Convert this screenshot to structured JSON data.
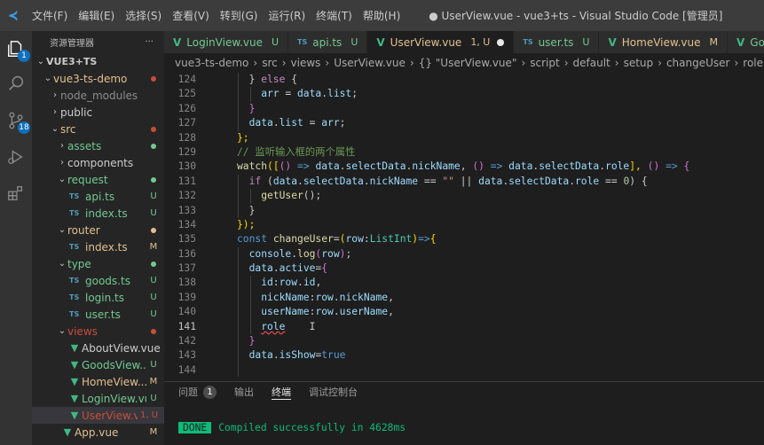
{
  "titlebar": {
    "menus": [
      "文件(F)",
      "编辑(E)",
      "选择(S)",
      "查看(V)",
      "转到(G)",
      "运行(R)",
      "终端(T)",
      "帮助(H)"
    ],
    "window_title": "● UserView.vue - vue3+ts - Visual Studio Code [管理员]"
  },
  "activity": {
    "scm_badge": "18",
    "explorer_badge": "1"
  },
  "sidebar": {
    "header": "资源管理器",
    "more": "···",
    "tree": [
      {
        "chev": "⌄",
        "label": "VUE3+TS",
        "depth": 0,
        "kind": "root"
      },
      {
        "chev": "⌄",
        "label": "vue3-ts-demo",
        "depth": 1,
        "kind": "folder",
        "color": "#e2c08d",
        "dot": "#c74e39"
      },
      {
        "chev": "›",
        "label": "node_modules",
        "depth": 2,
        "kind": "folder",
        "color": "#8c8c8c"
      },
      {
        "chev": "›",
        "label": "public",
        "depth": 2,
        "kind": "folder"
      },
      {
        "chev": "⌄",
        "label": "src",
        "depth": 2,
        "kind": "folder",
        "color": "#e2c08d",
        "dot": "#c74e39"
      },
      {
        "chev": "›",
        "label": "assets",
        "depth": 3,
        "kind": "folder",
        "color": "#73c991",
        "dot": "#73c991"
      },
      {
        "chev": "›",
        "label": "components",
        "depth": 3,
        "kind": "folder"
      },
      {
        "chev": "⌄",
        "label": "request",
        "depth": 3,
        "kind": "folder",
        "color": "#73c991",
        "dot": "#73c991"
      },
      {
        "label": "api.ts",
        "depth": 4,
        "kind": "ts",
        "color": "#73c991",
        "status": "U"
      },
      {
        "label": "index.ts",
        "depth": 4,
        "kind": "ts",
        "color": "#73c991",
        "status": "U"
      },
      {
        "chev": "⌄",
        "label": "router",
        "depth": 3,
        "kind": "folder",
        "color": "#e2c08d",
        "dot": "#e2c08d"
      },
      {
        "label": "index.ts",
        "depth": 4,
        "kind": "ts",
        "color": "#e2c08d",
        "status": "M"
      },
      {
        "chev": "⌄",
        "label": "type",
        "depth": 3,
        "kind": "folder",
        "color": "#73c991",
        "dot": "#73c991"
      },
      {
        "label": "goods.ts",
        "depth": 4,
        "kind": "ts",
        "color": "#73c991",
        "status": "U"
      },
      {
        "label": "login.ts",
        "depth": 4,
        "kind": "ts",
        "color": "#73c991",
        "status": "U"
      },
      {
        "label": "user.ts",
        "depth": 4,
        "kind": "ts",
        "color": "#73c991",
        "status": "U"
      },
      {
        "chev": "⌄",
        "label": "views",
        "depth": 3,
        "kind": "folder",
        "color": "#c74e39",
        "dot": "#c74e39"
      },
      {
        "label": "AboutView.vue",
        "depth": 4,
        "kind": "vue"
      },
      {
        "label": "GoodsView....",
        "depth": 4,
        "kind": "vue",
        "color": "#73c991",
        "status": "U"
      },
      {
        "label": "HomeView....",
        "depth": 4,
        "kind": "vue",
        "color": "#e2c08d",
        "status": "M"
      },
      {
        "label": "LoginView.vue",
        "depth": 4,
        "kind": "vue",
        "color": "#73c991",
        "status": "U"
      },
      {
        "label": "UserView.v...",
        "depth": 4,
        "kind": "vue",
        "color": "#c74e39",
        "status": "1, U",
        "selected": true
      },
      {
        "label": "App.vue",
        "depth": 3,
        "kind": "vue",
        "color": "#e2c08d",
        "status": "M"
      }
    ]
  },
  "tabs": [
    {
      "icon": "V",
      "label": "LoginView.vue",
      "mark": "U",
      "color": "#73c991"
    },
    {
      "icon": "TS",
      "label": "api.ts",
      "mark": "U",
      "color": "#73c991"
    },
    {
      "icon": "V",
      "label": "UserView.vue",
      "mark": "1, U",
      "color": "#e2c08d",
      "active": true
    },
    {
      "icon": "TS",
      "label": "user.ts",
      "mark": "U",
      "color": "#73c991"
    },
    {
      "icon": "V",
      "label": "HomeView.vue",
      "mark": "M",
      "color": "#e2c08d"
    },
    {
      "icon": "V",
      "label": "GoodsVi",
      "mark": "",
      "color": "#73c991"
    }
  ],
  "breadcrumb": [
    "vue3-ts-demo",
    "src",
    "views",
    "UserView.vue",
    "{} \"UserView.vue\"",
    "script",
    "default",
    "setup",
    "changeUser",
    "role"
  ],
  "code": {
    "current_line": 141,
    "lines": [
      {
        "n": 124,
        "i": 2,
        "tk": [
          [
            "} ",
            "p"
          ],
          [
            "else",
            "k"
          ],
          [
            " {",
            "p"
          ]
        ]
      },
      {
        "n": 125,
        "i": 3,
        "tk": [
          [
            "arr",
            "v"
          ],
          [
            " = ",
            "p"
          ],
          [
            "data",
            "v"
          ],
          [
            ".",
            "p"
          ],
          [
            "list",
            "v"
          ],
          [
            ";",
            "p"
          ]
        ]
      },
      {
        "n": 126,
        "i": 2,
        "tk": [
          [
            "}",
            "pk"
          ]
        ]
      },
      {
        "n": 127,
        "i": 2,
        "tk": [
          [
            "data",
            "v"
          ],
          [
            ".",
            "p"
          ],
          [
            "list",
            "v"
          ],
          [
            " = ",
            "p"
          ],
          [
            "arr",
            "v"
          ],
          [
            ";",
            "p"
          ]
        ]
      },
      {
        "n": 128,
        "i": 1,
        "tk": [
          [
            "};",
            "y"
          ]
        ]
      },
      {
        "n": 129,
        "i": 1,
        "tk": [
          [
            "// 监听输入框的两个属性",
            "c"
          ]
        ]
      },
      {
        "n": 130,
        "i": 1,
        "tk": [
          [
            "watch",
            "f"
          ],
          [
            "([",
            "y"
          ],
          [
            "() ",
            "pk"
          ],
          [
            "=>",
            "kb"
          ],
          [
            " ",
            "p"
          ],
          [
            "data",
            "v"
          ],
          [
            ".",
            "p"
          ],
          [
            "selectData",
            "v"
          ],
          [
            ".",
            "p"
          ],
          [
            "nickName",
            "v"
          ],
          [
            ", ",
            "p"
          ],
          [
            "() ",
            "pk"
          ],
          [
            "=>",
            "kb"
          ],
          [
            " ",
            "p"
          ],
          [
            "data",
            "v"
          ],
          [
            ".",
            "p"
          ],
          [
            "selectData",
            "v"
          ],
          [
            ".",
            "p"
          ],
          [
            "role",
            "v"
          ],
          [
            "], ",
            "y"
          ],
          [
            "() ",
            "pk"
          ],
          [
            "=>",
            "kb"
          ],
          [
            " {",
            "pk"
          ]
        ]
      },
      {
        "n": 131,
        "i": 2,
        "tk": [
          [
            "if",
            "k"
          ],
          [
            " (",
            "p"
          ],
          [
            "data",
            "v"
          ],
          [
            ".",
            "p"
          ],
          [
            "selectData",
            "v"
          ],
          [
            ".",
            "p"
          ],
          [
            "nickName",
            "v"
          ],
          [
            " == ",
            "p"
          ],
          [
            "\"\"",
            "s"
          ],
          [
            " || ",
            "p"
          ],
          [
            "data",
            "v"
          ],
          [
            ".",
            "p"
          ],
          [
            "selectData",
            "v"
          ],
          [
            ".",
            "p"
          ],
          [
            "role",
            "v"
          ],
          [
            " == ",
            "p"
          ],
          [
            "0",
            "n"
          ],
          [
            ") {",
            "p"
          ]
        ]
      },
      {
        "n": 132,
        "i": 3,
        "tk": [
          [
            "getUser",
            "f"
          ],
          [
            "();",
            "p"
          ]
        ]
      },
      {
        "n": 133,
        "i": 2,
        "tk": [
          [
            "}",
            "p"
          ]
        ]
      },
      {
        "n": 134,
        "i": 1,
        "tk": [
          [
            "});",
            "y"
          ]
        ]
      },
      {
        "n": 135,
        "i": 1,
        "tk": [
          [
            "const",
            "kb"
          ],
          [
            " ",
            "p"
          ],
          [
            "changeUser",
            "f"
          ],
          [
            "=",
            "p"
          ],
          [
            "(",
            "y"
          ],
          [
            "row",
            "v"
          ],
          [
            ":",
            "p"
          ],
          [
            "ListInt",
            "t"
          ],
          [
            ")",
            "y"
          ],
          [
            "=>",
            "kb"
          ],
          [
            "{",
            "y"
          ]
        ]
      },
      {
        "n": 136,
        "i": 2,
        "tk": [
          [
            "console",
            "v"
          ],
          [
            ".",
            "p"
          ],
          [
            "log",
            "f"
          ],
          [
            "(",
            "pk"
          ],
          [
            "row",
            "v"
          ],
          [
            ")",
            "pk"
          ],
          [
            ";",
            "p"
          ]
        ]
      },
      {
        "n": 137,
        "i": 2,
        "tk": [
          [
            "data",
            "v"
          ],
          [
            ".",
            "p"
          ],
          [
            "active",
            "v"
          ],
          [
            "=",
            "p"
          ],
          [
            "{",
            "pk"
          ]
        ]
      },
      {
        "n": 138,
        "i": 3,
        "tk": [
          [
            "id",
            "v"
          ],
          [
            ":",
            "p"
          ],
          [
            "row",
            "v"
          ],
          [
            ".",
            "p"
          ],
          [
            "id",
            "v"
          ],
          [
            ",",
            "p"
          ]
        ]
      },
      {
        "n": 139,
        "i": 3,
        "tk": [
          [
            "nickName",
            "v"
          ],
          [
            ":",
            "p"
          ],
          [
            "row",
            "v"
          ],
          [
            ".",
            "p"
          ],
          [
            "nickName",
            "v"
          ],
          [
            ",",
            "p"
          ]
        ]
      },
      {
        "n": 140,
        "i": 3,
        "tk": [
          [
            "userName",
            "v"
          ],
          [
            ":",
            "p"
          ],
          [
            "row",
            "v"
          ],
          [
            ".",
            "p"
          ],
          [
            "userName",
            "v"
          ],
          [
            ",",
            "p"
          ]
        ]
      },
      {
        "n": 141,
        "i": 3,
        "tk": [
          [
            "role",
            "v"
          ],
          [
            "    I",
            "p"
          ]
        ]
      },
      {
        "n": 142,
        "i": 2,
        "tk": [
          [
            "}",
            "pk"
          ]
        ]
      },
      {
        "n": 143,
        "i": 2,
        "tk": [
          [
            "data",
            "v"
          ],
          [
            ".",
            "p"
          ],
          [
            "isShow",
            "v"
          ],
          [
            "=",
            "p"
          ],
          [
            "true",
            "kb"
          ]
        ]
      },
      {
        "n": 144,
        "i": 2,
        "tk": []
      }
    ]
  },
  "panel": {
    "tabs": [
      {
        "label": "问题",
        "badge": "1"
      },
      {
        "label": "输出"
      },
      {
        "label": "终端",
        "active": true
      },
      {
        "label": "调试控制台"
      }
    ],
    "done_label": "DONE",
    "message": "Compiled successfully in 4628ms"
  }
}
